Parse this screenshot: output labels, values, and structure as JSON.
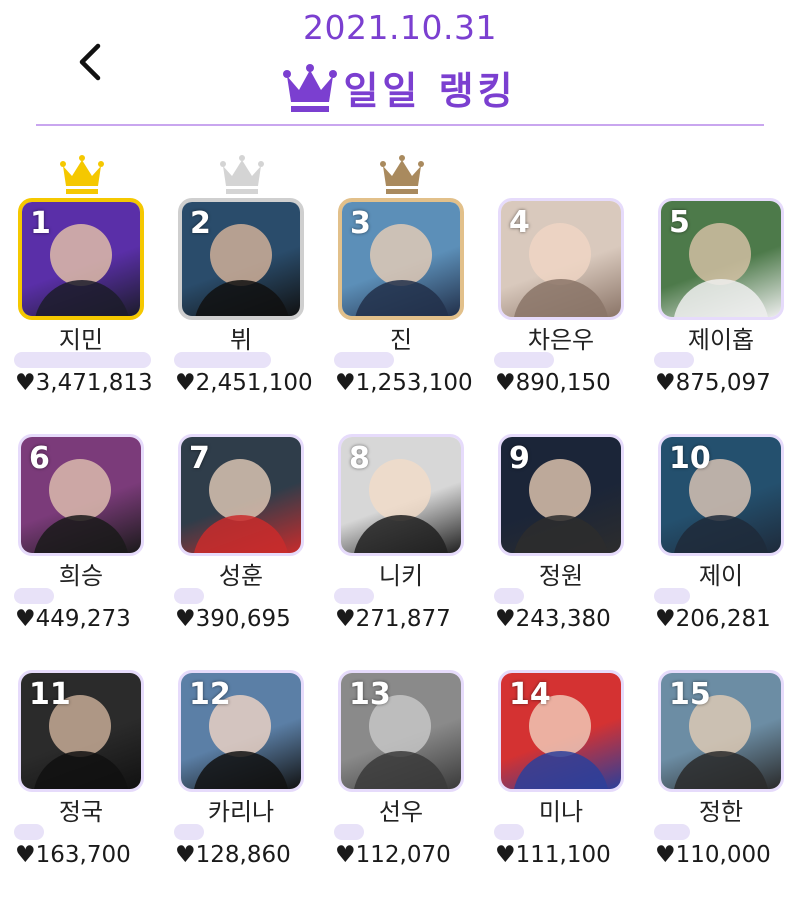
{
  "header": {
    "date": "2021.10.31",
    "title": "일일 랭킹",
    "back_icon": "chevron-left-icon",
    "title_icon": "crown-icon",
    "accent_color": "#7b3fd0"
  },
  "rankings": [
    {
      "rank": "1",
      "name": "지민",
      "score": "♥3,471,813",
      "crown": "gold"
    },
    {
      "rank": "2",
      "name": "뷔",
      "score": "♥2,451,100",
      "crown": "silver"
    },
    {
      "rank": "3",
      "name": "진",
      "score": "♥1,253,100",
      "crown": "bronze"
    },
    {
      "rank": "4",
      "name": "차은우",
      "score": "♥890,150",
      "crown": ""
    },
    {
      "rank": "5",
      "name": "제이홉",
      "score": "♥875,097",
      "crown": ""
    },
    {
      "rank": "6",
      "name": "희승",
      "score": "♥449,273",
      "crown": ""
    },
    {
      "rank": "7",
      "name": "성훈",
      "score": "♥390,695",
      "crown": ""
    },
    {
      "rank": "8",
      "name": "니키",
      "score": "♥271,877",
      "crown": ""
    },
    {
      "rank": "9",
      "name": "정원",
      "score": "♥243,380",
      "crown": ""
    },
    {
      "rank": "10",
      "name": "제이",
      "score": "♥206,281",
      "crown": ""
    },
    {
      "rank": "11",
      "name": "정국",
      "score": "♥163,700",
      "crown": ""
    },
    {
      "rank": "12",
      "name": "카리나",
      "score": "♥128,860",
      "crown": ""
    },
    {
      "rank": "13",
      "name": "선우",
      "score": "♥112,070",
      "crown": ""
    },
    {
      "rank": "14",
      "name": "미나",
      "score": "♥111,100",
      "crown": ""
    },
    {
      "rank": "15",
      "name": "정한",
      "score": "♥110,000",
      "crown": ""
    }
  ],
  "crown_colors": {
    "gold": "#f5c800",
    "silver": "#d4d4d4",
    "bronze": "#a98a5e"
  }
}
